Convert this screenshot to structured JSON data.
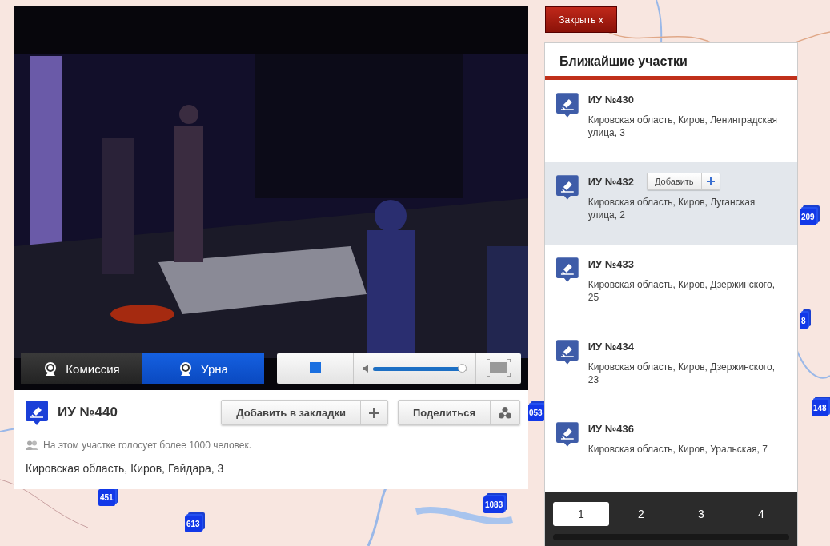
{
  "close_button": "Закрыть x",
  "video": {
    "camera_tabs": [
      {
        "label": "Комиссия",
        "selected": false
      },
      {
        "label": "Урна",
        "selected": true
      }
    ],
    "volume": {
      "level": 0.95
    }
  },
  "station": {
    "title": "ИУ №440",
    "buttons": [
      {
        "label": "Добавить в закладки",
        "kind": "add"
      },
      {
        "label": "Поделиться",
        "kind": "share"
      }
    ],
    "note": "На этом участке голосует более 1000 человек.",
    "address": "Кировская область, Киров, Гайдара, 3"
  },
  "nearby": {
    "title": "Ближайшие участки",
    "items": [
      {
        "title": "ИУ №430",
        "address": "Кировская область, Киров, Ленинградская улица, 3",
        "selected": false
      },
      {
        "title": "ИУ №432",
        "address": "Кировская область, Киров, Луганская улица, 2",
        "selected": true,
        "add_button": "Добавить"
      },
      {
        "title": "ИУ №433",
        "address": "Кировская область, Киров, Дзержинского, 25",
        "selected": false
      },
      {
        "title": "ИУ №434",
        "address": "Кировская область, Киров, Дзержинского, 23",
        "selected": false
      },
      {
        "title": "ИУ №436",
        "address": "Кировская область, Киров, Уральская, 7",
        "selected": false
      }
    ]
  },
  "pagination": [
    {
      "label": "1",
      "selected": true
    },
    {
      "label": "2",
      "selected": false
    },
    {
      "label": "3",
      "selected": false
    },
    {
      "label": "4",
      "selected": false
    }
  ],
  "map_markers": [
    {
      "count": "451"
    },
    {
      "count": "613"
    },
    {
      "count": "1083"
    },
    {
      "count": "209"
    },
    {
      "count": "148"
    },
    {
      "count": "053"
    },
    {
      "count": "8"
    }
  ]
}
